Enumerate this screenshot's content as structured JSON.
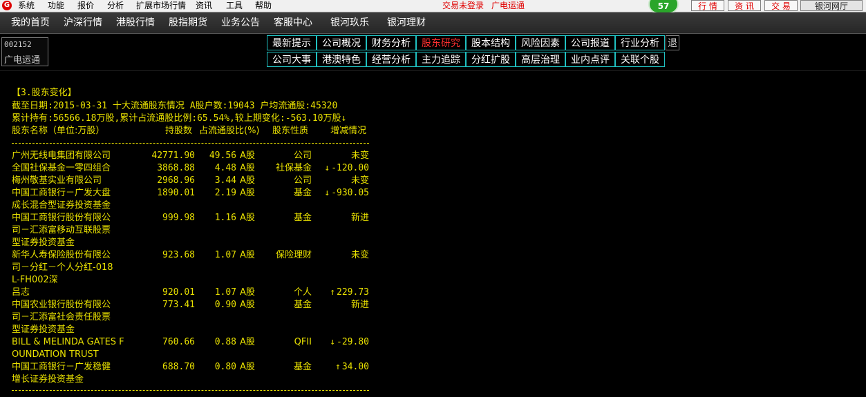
{
  "menubar": {
    "items": [
      "系统",
      "功能",
      "报价",
      "分析",
      "扩展市场行情",
      "资讯",
      "工具",
      "帮助"
    ],
    "status_login": "交易未登录",
    "status_stock": "广电运通",
    "badge": "57",
    "buttons": [
      "行 情",
      "资 讯",
      "交 易",
      "银河网厅"
    ]
  },
  "nav": {
    "items": [
      "我的首页",
      "沪深行情",
      "港股行情",
      "股指期货",
      "业务公告",
      "客服中心",
      "银河玖乐",
      "银河理财"
    ]
  },
  "stock": {
    "code": "002152",
    "name": "广电运通"
  },
  "tabs": {
    "row1": [
      "最新提示",
      "公司概况",
      "财务分析",
      "股东研究",
      "股本结构",
      "风险因素",
      "公司报道",
      "行业分析"
    ],
    "row2": [
      "公司大事",
      "港澳特色",
      "经营分析",
      "主力追踪",
      "分红扩股",
      "高层治理",
      "业内点评",
      "关联个股"
    ],
    "active": "股东研究",
    "side": "退"
  },
  "report": {
    "section_title": "【3.股东变化】",
    "summary1": "截至日期:2015-03-31 十大流通股东情况 A股户数:19043 户均流通股:45320",
    "summary2": "累计持有:56566.18万股,累计占流通股比例:65.54%,较上期变化:-563.10万股↓",
    "headers": {
      "name": "股东名称（单位:万股）",
      "shares": "持股数",
      "ratio": "占流通股比(%)",
      "type": "股东性质",
      "change": "增减情况"
    },
    "rows": [
      {
        "name_lines": [
          "广州无线电集团有限公司"
        ],
        "shares": "42771.90",
        "ratio": "49.56",
        "cls": "A股",
        "type": "公司",
        "change": "未变",
        "dir": ""
      },
      {
        "name_lines": [
          "全国社保基金一零四组合"
        ],
        "shares": "3868.88",
        "ratio": "4.48",
        "cls": "A股",
        "type": "社保基金",
        "change": "-120.00",
        "dir": "↓"
      },
      {
        "name_lines": [
          "梅州敬基实业有限公司"
        ],
        "shares": "2968.96",
        "ratio": "3.44",
        "cls": "A股",
        "type": "公司",
        "change": "未变",
        "dir": ""
      },
      {
        "name_lines": [
          "中国工商银行－广发大盘",
          "成长混合型证券投资基金"
        ],
        "shares": "1890.01",
        "ratio": "2.19",
        "cls": "A股",
        "type": "基金",
        "change": "-930.05",
        "dir": "↓"
      },
      {
        "name_lines": [
          "中国工商银行股份有限公",
          "司－汇添富移动互联股票",
          "型证券投资基金"
        ],
        "shares": "999.98",
        "ratio": "1.16",
        "cls": "A股",
        "type": "基金",
        "change": "新进",
        "dir": ""
      },
      {
        "name_lines": [
          "新华人寿保险股份有限公",
          "司－分红－个人分红-018",
          "L-FH002深"
        ],
        "shares": "923.68",
        "ratio": "1.07",
        "cls": "A股",
        "type": "保险理财",
        "change": "未变",
        "dir": ""
      },
      {
        "name_lines": [
          "吕志"
        ],
        "shares": "920.01",
        "ratio": "1.07",
        "cls": "A股",
        "type": "个人",
        "change": "229.73",
        "dir": "↑"
      },
      {
        "name_lines": [
          "中国农业银行股份有限公",
          "司－汇添富社会责任股票",
          "型证券投资基金"
        ],
        "shares": "773.41",
        "ratio": "0.90",
        "cls": "A股",
        "type": "基金",
        "change": "新进",
        "dir": ""
      },
      {
        "name_lines": [
          "BILL & MELINDA GATES F",
          "OUNDATION TRUST"
        ],
        "shares": "760.66",
        "ratio": "0.88",
        "cls": "A股",
        "type": "QFII",
        "change": "-29.80",
        "dir": "↓"
      },
      {
        "name_lines": [
          "中国工商银行－广发稳健",
          "增长证券投资基金"
        ],
        "shares": "688.70",
        "ratio": "0.80",
        "cls": "A股",
        "type": "基金",
        "change": "34.00",
        "dir": "↑"
      }
    ]
  }
}
